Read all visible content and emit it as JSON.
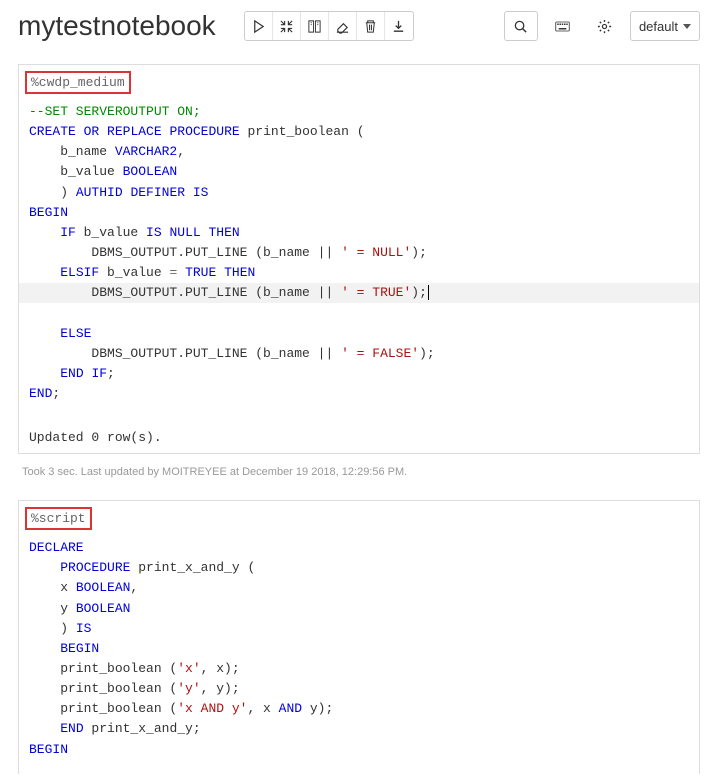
{
  "title": "mytestnotebook",
  "dropdown": {
    "selected": "default"
  },
  "paragraph1": {
    "interpreter": "%cwdp_medium",
    "code_tokens": [
      {
        "t": "comment",
        "v": "--SET SERVEROUTPUT ON;\n"
      },
      {
        "t": "kw",
        "v": "CREATE"
      },
      {
        "t": "plain",
        "v": " "
      },
      {
        "t": "kw",
        "v": "OR"
      },
      {
        "t": "plain",
        "v": " "
      },
      {
        "t": "kw",
        "v": "REPLACE"
      },
      {
        "t": "plain",
        "v": " "
      },
      {
        "t": "kw",
        "v": "PROCEDURE"
      },
      {
        "t": "plain",
        "v": " print_boolean (\n"
      },
      {
        "t": "plain",
        "v": "    b_name "
      },
      {
        "t": "kw",
        "v": "VARCHAR2"
      },
      {
        "t": "plain",
        "v": ",\n"
      },
      {
        "t": "plain",
        "v": "    b_value "
      },
      {
        "t": "kw",
        "v": "BOOLEAN"
      },
      {
        "t": "plain",
        "v": "\n"
      },
      {
        "t": "plain",
        "v": "    ) "
      },
      {
        "t": "kw",
        "v": "AUTHID"
      },
      {
        "t": "plain",
        "v": " "
      },
      {
        "t": "kw",
        "v": "DEFINER"
      },
      {
        "t": "plain",
        "v": " "
      },
      {
        "t": "kw",
        "v": "IS"
      },
      {
        "t": "plain",
        "v": "\n"
      },
      {
        "t": "kw",
        "v": "BEGIN"
      },
      {
        "t": "plain",
        "v": "\n"
      },
      {
        "t": "plain",
        "v": "    "
      },
      {
        "t": "kw",
        "v": "IF"
      },
      {
        "t": "plain",
        "v": " b_value "
      },
      {
        "t": "kw",
        "v": "IS"
      },
      {
        "t": "plain",
        "v": " "
      },
      {
        "t": "kw",
        "v": "NULL"
      },
      {
        "t": "plain",
        "v": " "
      },
      {
        "t": "kw",
        "v": "THEN"
      },
      {
        "t": "plain",
        "v": "\n"
      },
      {
        "t": "plain",
        "v": "        DBMS_OUTPUT.PUT_LINE (b_name || "
      },
      {
        "t": "str",
        "v": "' = NULL'"
      },
      {
        "t": "plain",
        "v": ");\n"
      },
      {
        "t": "plain",
        "v": "    "
      },
      {
        "t": "kw",
        "v": "ELSIF"
      },
      {
        "t": "plain",
        "v": " b_value "
      },
      {
        "t": "op",
        "v": "="
      },
      {
        "t": "plain",
        "v": " "
      },
      {
        "t": "kw",
        "v": "TRUE"
      },
      {
        "t": "plain",
        "v": " "
      },
      {
        "t": "kw",
        "v": "THEN"
      },
      {
        "t": "plain",
        "v": "\n"
      },
      {
        "t": "hl_start",
        "v": ""
      },
      {
        "t": "plain",
        "v": "        DBMS_OUTPUT.PUT_LINE (b_name || "
      },
      {
        "t": "str",
        "v": "' = TRUE'"
      },
      {
        "t": "plain",
        "v": ");"
      },
      {
        "t": "caret",
        "v": ""
      },
      {
        "t": "hl_end",
        "v": ""
      },
      {
        "t": "plain",
        "v": "\n"
      },
      {
        "t": "plain",
        "v": "    "
      },
      {
        "t": "kw",
        "v": "ELSE"
      },
      {
        "t": "plain",
        "v": "\n"
      },
      {
        "t": "plain",
        "v": "        DBMS_OUTPUT.PUT_LINE (b_name || "
      },
      {
        "t": "str",
        "v": "' = FALSE'"
      },
      {
        "t": "plain",
        "v": ");\n"
      },
      {
        "t": "plain",
        "v": "    "
      },
      {
        "t": "kw",
        "v": "END"
      },
      {
        "t": "plain",
        "v": " "
      },
      {
        "t": "kw",
        "v": "IF"
      },
      {
        "t": "plain",
        "v": ";\n"
      },
      {
        "t": "kw",
        "v": "END"
      },
      {
        "t": "plain",
        "v": ";"
      }
    ],
    "output": "Updated 0 row(s).",
    "status": "Took 3 sec. Last updated by MOITREYEE at December 19 2018, 12:29:56 PM."
  },
  "paragraph2": {
    "interpreter": "%script",
    "code_tokens": [
      {
        "t": "kw",
        "v": "DECLARE"
      },
      {
        "t": "plain",
        "v": "\n"
      },
      {
        "t": "plain",
        "v": "    "
      },
      {
        "t": "kw",
        "v": "PROCEDURE"
      },
      {
        "t": "plain",
        "v": " print_x_and_y (\n"
      },
      {
        "t": "plain",
        "v": "    x "
      },
      {
        "t": "kw",
        "v": "BOOLEAN"
      },
      {
        "t": "plain",
        "v": ",\n"
      },
      {
        "t": "plain",
        "v": "    y "
      },
      {
        "t": "kw",
        "v": "BOOLEAN"
      },
      {
        "t": "plain",
        "v": "\n"
      },
      {
        "t": "plain",
        "v": "    ) "
      },
      {
        "t": "kw",
        "v": "IS"
      },
      {
        "t": "plain",
        "v": "\n"
      },
      {
        "t": "plain",
        "v": "    "
      },
      {
        "t": "kw",
        "v": "BEGIN"
      },
      {
        "t": "plain",
        "v": "\n"
      },
      {
        "t": "plain",
        "v": "    print_boolean ("
      },
      {
        "t": "str",
        "v": "'x'"
      },
      {
        "t": "plain",
        "v": ", x);\n"
      },
      {
        "t": "plain",
        "v": "    print_boolean ("
      },
      {
        "t": "str",
        "v": "'y'"
      },
      {
        "t": "plain",
        "v": ", y);\n"
      },
      {
        "t": "plain",
        "v": "    print_boolean ("
      },
      {
        "t": "str",
        "v": "'x AND y'"
      },
      {
        "t": "plain",
        "v": ", x "
      },
      {
        "t": "kw",
        "v": "AND"
      },
      {
        "t": "plain",
        "v": " y);\n"
      },
      {
        "t": "plain",
        "v": "    "
      },
      {
        "t": "kw",
        "v": "END"
      },
      {
        "t": "plain",
        "v": " print_x_and_y;\n"
      },
      {
        "t": "kw",
        "v": "BEGIN"
      }
    ]
  }
}
